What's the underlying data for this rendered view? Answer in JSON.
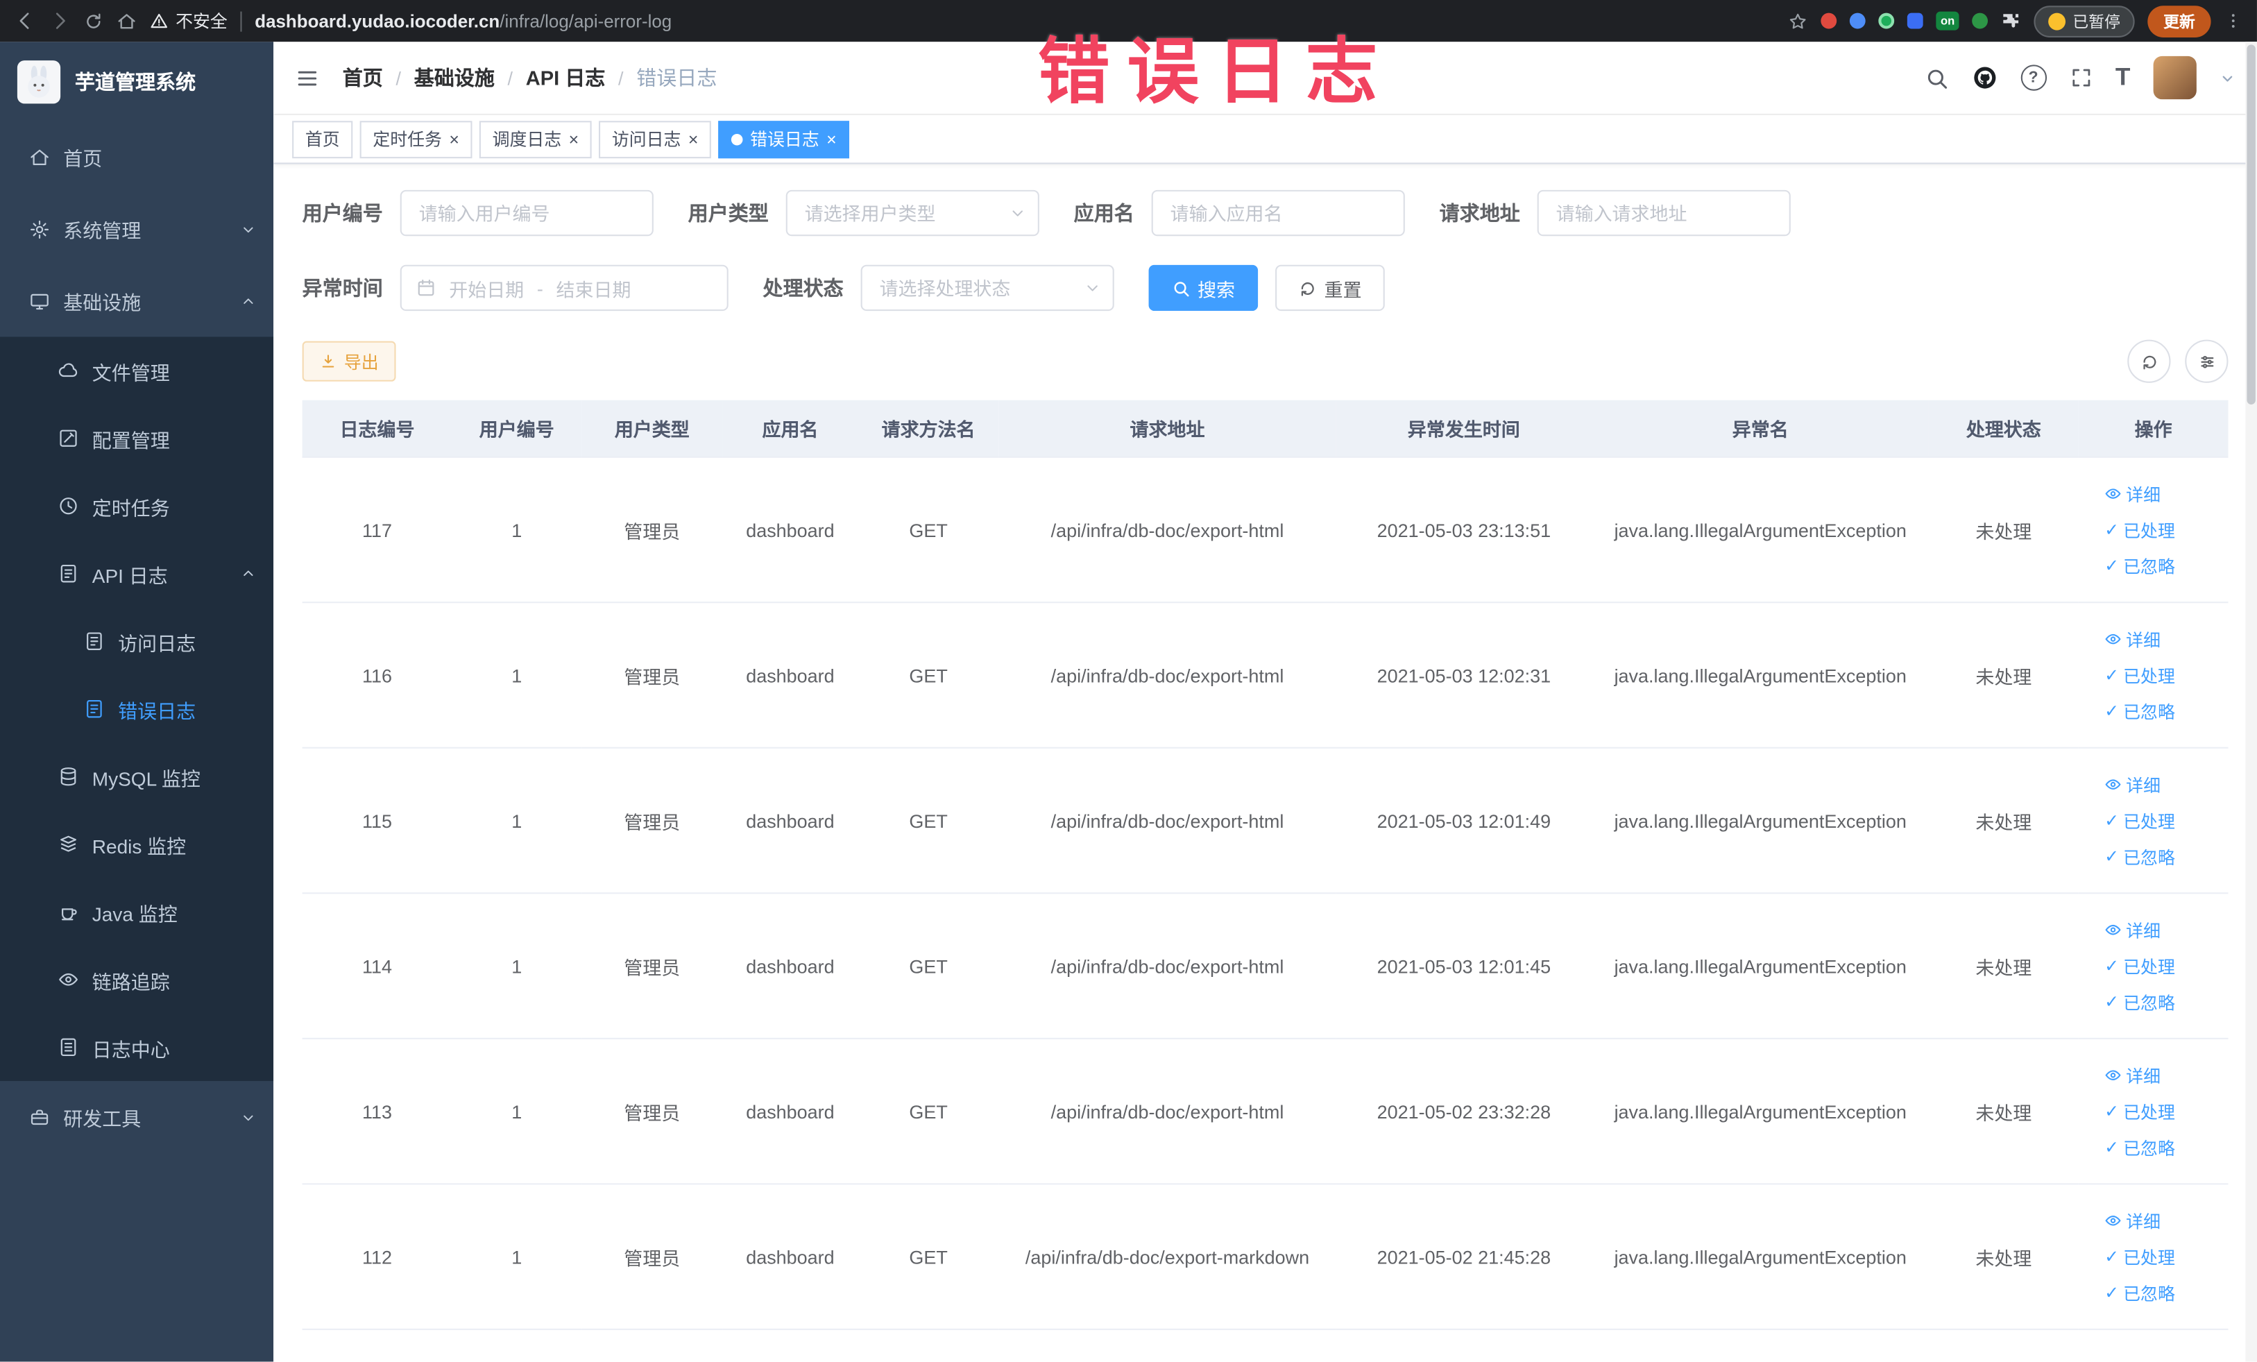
{
  "theme": {
    "primary": "#409EFF",
    "sidebar_bg": "#304156",
    "submenu_bg": "#1f2d3d",
    "warning": "#e6a23c",
    "annotation_color": "#f1435f",
    "table_header_bg": "#edf1f7"
  },
  "browser": {
    "security_label": "不安全",
    "url_host": "dashboard.yudao.iocoder.cn",
    "url_path": "/infra/log/api-error-log",
    "extension_badge": "on",
    "paused_label": "已暂停",
    "update_label": "更新"
  },
  "annotation": {
    "text": "错误日志"
  },
  "sidebar": {
    "logo_title": "芋道管理系统",
    "items": {
      "home": "首页",
      "system": "系统管理",
      "infra": "基础设施",
      "file": "文件管理",
      "config": "配置管理",
      "job": "定时任务",
      "api_log": "API 日志",
      "access_log": "访问日志",
      "error_log": "错误日志",
      "mysql": "MySQL 监控",
      "redis": "Redis 监控",
      "java": "Java 监控",
      "trace": "链路追踪",
      "log_center": "日志中心",
      "dev_tools": "研发工具"
    }
  },
  "header": {
    "breadcrumb": [
      "首页",
      "基础设施",
      "API 日志",
      "错误日志"
    ],
    "separator": "/"
  },
  "tabs": [
    {
      "label": "首页"
    },
    {
      "label": "定时任务"
    },
    {
      "label": "调度日志"
    },
    {
      "label": "访问日志"
    },
    {
      "label": "错误日志"
    }
  ],
  "filters": {
    "user_id_label": "用户编号",
    "user_id_placeholder": "请输入用户编号",
    "user_type_label": "用户类型",
    "user_type_placeholder": "请选择用户类型",
    "app_name_label": "应用名",
    "app_name_placeholder": "请输入应用名",
    "request_url_label": "请求地址",
    "request_url_placeholder": "请输入请求地址",
    "exception_time_label": "异常时间",
    "date_start_placeholder": "开始日期",
    "date_separator": "-",
    "date_end_placeholder": "结束日期",
    "process_status_label": "处理状态",
    "process_status_placeholder": "请选择处理状态",
    "search_label": "搜索",
    "reset_label": "重置"
  },
  "toolbar": {
    "export_label": "导出"
  },
  "table": {
    "columns": [
      "日志编号",
      "用户编号",
      "用户类型",
      "应用名",
      "请求方法名",
      "请求地址",
      "异常发生时间",
      "异常名",
      "处理状态",
      "操作"
    ],
    "rows": [
      {
        "log_id": "117",
        "user_id": "1",
        "user_type": "管理员",
        "app_name": "dashboard",
        "method": "GET",
        "url": "/api/infra/db-doc/export-html",
        "time": "2021-05-03 23:13:51",
        "exception": "java.lang.IllegalArgumentException",
        "status": "未处理"
      },
      {
        "log_id": "116",
        "user_id": "1",
        "user_type": "管理员",
        "app_name": "dashboard",
        "method": "GET",
        "url": "/api/infra/db-doc/export-html",
        "time": "2021-05-03 12:02:31",
        "exception": "java.lang.IllegalArgumentException",
        "status": "未处理"
      },
      {
        "log_id": "115",
        "user_id": "1",
        "user_type": "管理员",
        "app_name": "dashboard",
        "method": "GET",
        "url": "/api/infra/db-doc/export-html",
        "time": "2021-05-03 12:01:49",
        "exception": "java.lang.IllegalArgumentException",
        "status": "未处理"
      },
      {
        "log_id": "114",
        "user_id": "1",
        "user_type": "管理员",
        "app_name": "dashboard",
        "method": "GET",
        "url": "/api/infra/db-doc/export-html",
        "time": "2021-05-03 12:01:45",
        "exception": "java.lang.IllegalArgumentException",
        "status": "未处理"
      },
      {
        "log_id": "113",
        "user_id": "1",
        "user_type": "管理员",
        "app_name": "dashboard",
        "method": "GET",
        "url": "/api/infra/db-doc/export-html",
        "time": "2021-05-02 23:32:28",
        "exception": "java.lang.IllegalArgumentException",
        "status": "未处理"
      },
      {
        "log_id": "112",
        "user_id": "1",
        "user_type": "管理员",
        "app_name": "dashboard",
        "method": "GET",
        "url": "/api/infra/db-doc/export-markdown",
        "time": "2021-05-02 21:45:28",
        "exception": "java.lang.IllegalArgumentException",
        "status": "未处理"
      }
    ],
    "actions": {
      "detail": "详细",
      "processed": "已处理",
      "ignored": "已忽略"
    }
  },
  "icons": {
    "question": "?",
    "text_size": "T",
    "check": "✓",
    "close": "×"
  }
}
